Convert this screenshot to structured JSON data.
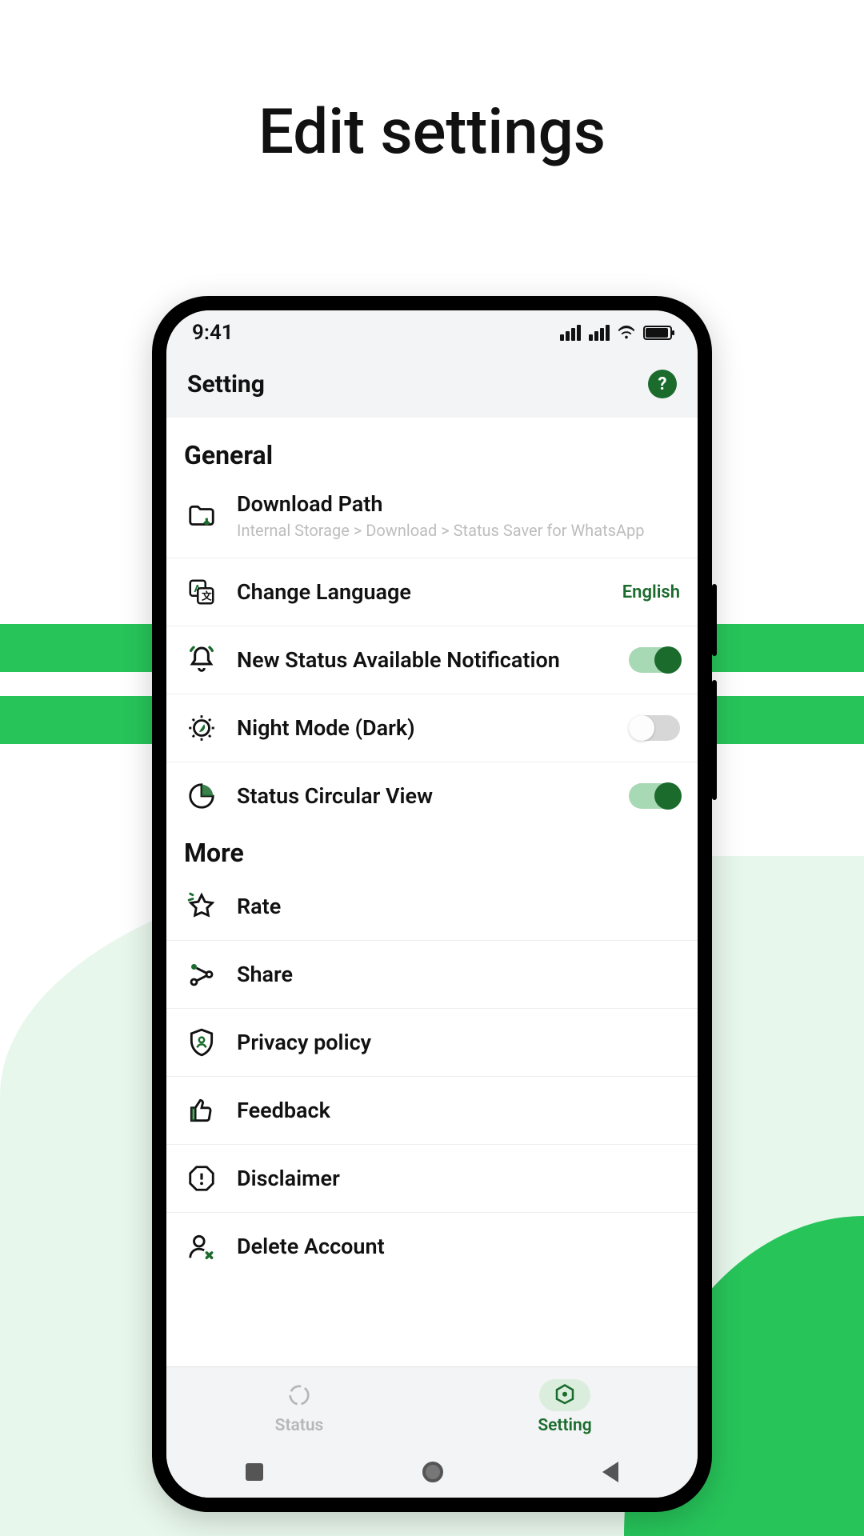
{
  "page_title": "Edit settings",
  "statusbar": {
    "time": "9:41"
  },
  "header": {
    "title": "Setting",
    "help_icon": "help-icon"
  },
  "sections": {
    "general": {
      "title": "General",
      "download_path": {
        "label": "Download Path",
        "sub": "Internal Storage > Download > Status Saver for WhatsApp"
      },
      "language": {
        "label": "Change Language",
        "value": "English"
      },
      "notification": {
        "label": "New Status Available Notification",
        "on": true
      },
      "night_mode": {
        "label": "Night Mode (Dark)",
        "on": false
      },
      "circular_view": {
        "label": "Status Circular View",
        "on": true
      }
    },
    "more": {
      "title": "More",
      "rate": {
        "label": "Rate"
      },
      "share": {
        "label": "Share"
      },
      "privacy": {
        "label": "Privacy policy"
      },
      "feedback": {
        "label": "Feedback"
      },
      "disclaimer": {
        "label": "Disclaimer"
      },
      "delete": {
        "label": "Delete Account"
      }
    }
  },
  "tabs": {
    "status": {
      "label": "Status"
    },
    "setting": {
      "label": "Setting"
    }
  },
  "colors": {
    "accent": "#1a6b2c",
    "brand": "#27c45a"
  }
}
